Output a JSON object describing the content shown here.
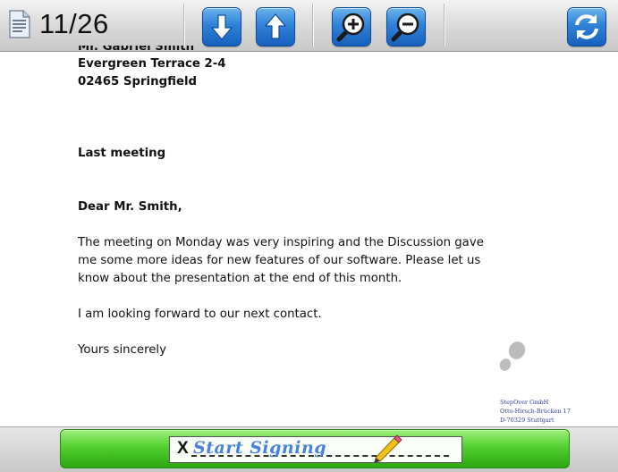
{
  "toolbar": {
    "page_indicator": "11/26",
    "buttons": [
      {
        "name": "next-page-button",
        "icon": "arrow-down-icon"
      },
      {
        "name": "prev-page-button",
        "icon": "arrow-up-icon"
      },
      {
        "name": "zoom-in-button",
        "icon": "zoom-in-icon"
      },
      {
        "name": "zoom-out-button",
        "icon": "zoom-out-icon"
      },
      {
        "name": "refresh-button",
        "icon": "refresh-icon"
      }
    ]
  },
  "document": {
    "recipient_name_partial": "Mr. Gabriel Smith",
    "address_line1": "Evergreen Terrace 2-4",
    "address_line2": "02465 Springfield",
    "subject": "Last meeting",
    "salutation": "Dear Mr. Smith,",
    "body_lines": [
      "The meeting on Monday was very inspiring and the Discussion gave",
      "me some more ideas for new features of our software. Please let us",
      "know about the presentation at the end of this month."
    ],
    "closing_paragraph": "I am looking forward to our next contact.",
    "closing": "Yours sincerely",
    "company_block": [
      "StepOver GmbH",
      "Otto-Hirsch-Brücken 17",
      "D-70329 Stuttgart"
    ]
  },
  "signing": {
    "start_label": "Start Signing",
    "x_mark": "X"
  },
  "colors": {
    "toolbar_button": "#2f82d6",
    "sign_button": "#52cf2f",
    "signature_text": "#4a82d9",
    "company_text": "#33449a"
  }
}
